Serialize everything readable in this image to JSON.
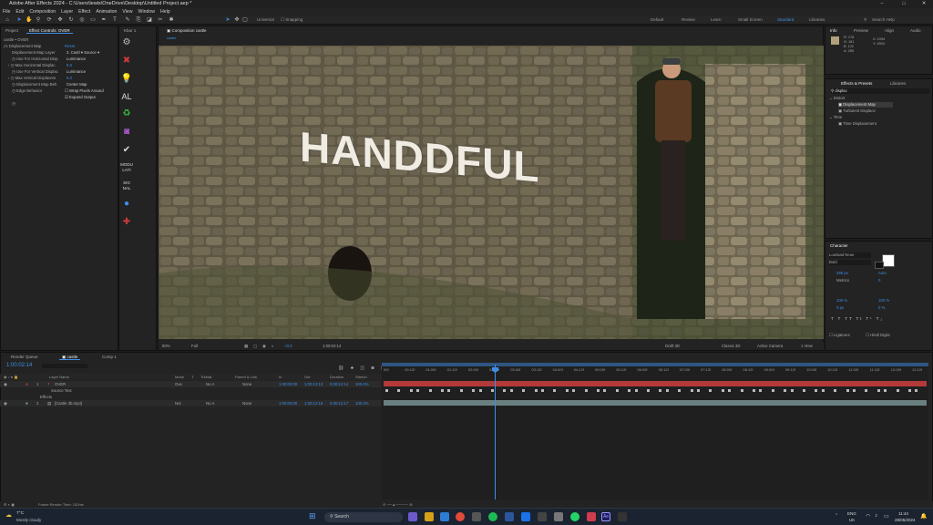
{
  "title": "Adobe After Effects 2024 - C:\\Users\\lewis\\OneDrive\\Desktop\\Untitled Project.aep *",
  "menu": [
    "File",
    "Edit",
    "Composition",
    "Layer",
    "Effect",
    "Animation",
    "View",
    "Window",
    "Help"
  ],
  "toolbar": {
    "universal": "Universal",
    "snapping": "Snapping",
    "workspaces": [
      "Default",
      "Review",
      "Learn",
      "Small Screen",
      "Standard",
      "Libraries"
    ],
    "search_placeholder": "Search Help"
  },
  "left_panel": {
    "tab_project": "Project",
    "tab_effect": "Effect Controls: OVER",
    "layer_path": "castle • OVER",
    "effect_name": "Displacement Map",
    "reset": "Reset",
    "props": [
      {
        "label": "Displacement Map Layer",
        "value": "2. Castl",
        "value2": "Source"
      },
      {
        "label": "Use For Horizontal Disp",
        "value": "Luminance"
      },
      {
        "label": "Max Horizontal Displac",
        "value": "5.0"
      },
      {
        "label": "Use For Vertical Displac",
        "value": "Luminance"
      },
      {
        "label": "Max Vertical Displacem",
        "value": "5.0"
      },
      {
        "label": "Displacement Map Beh",
        "value": "Center Map"
      },
      {
        "label": "Edge Behavior",
        "value": "Wrap Pixels Around"
      },
      {
        "label": "",
        "value": "Expand Output"
      }
    ]
  },
  "kbar": {
    "tab": "Kbar 1",
    "labels": [
      "AL",
      "MODU\nLATI",
      "SIG\nNAL"
    ]
  },
  "composition": {
    "tab": "Composition castle",
    "sub_tab": "castle",
    "overlay_text": "HANDDFUL",
    "zoom": "50%",
    "res": "Full",
    "timecode": "1:00:02:14",
    "draft": "Draft 3D",
    "renderer": "Classic 3D",
    "camera": "Active Camera",
    "views": "1 View"
  },
  "info": {
    "tabs": [
      "Info",
      "Preview",
      "Align",
      "Audio"
    ],
    "r": "R: 178",
    "g": "G: 161",
    "b": "B: 122",
    "a": "A: 255",
    "x": "X: 1094",
    "y": "Y: 1604"
  },
  "effects_presets": {
    "tabs": [
      "Effects & Presets",
      "Libraries"
    ],
    "search": "displac",
    "items": [
      "Distort",
      "Displacement Map",
      "Turbulent Displace",
      "Time",
      "Time Displacement"
    ]
  },
  "character": {
    "tab": "Character",
    "font": "Lowload Neue",
    "style": "Bold",
    "size": "290 px",
    "leading": "Auto",
    "tracking": "0",
    "kern": "Metrics",
    "h_scale": "100 %",
    "v_scale": "100 %",
    "baseline": "0 px",
    "tsume": "0 %",
    "ligatures": "Ligatures",
    "hindi": "Hindi Digits"
  },
  "timeline": {
    "tabs": [
      "Render Queue",
      "castle",
      "Comp 1"
    ],
    "timecode": "1:00:02:14",
    "headers": [
      "Layer Name",
      "Mode",
      "T",
      "TrkMat",
      "Parent & Link",
      "In",
      "Out",
      "Duration",
      "Stretch"
    ],
    "layers": [
      {
        "num": "1",
        "name": "OVER",
        "mode": "Ove",
        "trk": "No A",
        "parent": "None",
        "in": "1:00:00:00",
        "out": "1:00:12:13",
        "dur": "0:00:12:14",
        "stretch": "100.0%"
      },
      {
        "num": "",
        "name": "Source Text",
        "mode": "",
        "trk": "",
        "parent": "",
        "in": "",
        "out": "",
        "dur": "",
        "stretch": ""
      },
      {
        "num": "",
        "name": "Effects",
        "mode": "",
        "trk": "",
        "parent": "",
        "in": "",
        "out": "",
        "dur": "",
        "stretch": ""
      },
      {
        "num": "2",
        "name": "[Castle 3b.mp4]",
        "mode": "Nor",
        "trk": "No A",
        "parent": "None",
        "in": "1:00:00:00",
        "out": "1:00:12:16",
        "dur": "0:00:12:17",
        "stretch": "100.0%"
      }
    ],
    "ruler": [
      "00f",
      "00:12f",
      "01:00f",
      "01:12f",
      "02:00f",
      "02:12f",
      "03:00f",
      "03:12f",
      "04:00f",
      "04:12f",
      "05:00f",
      "05:12f",
      "06:00f",
      "06:12f",
      "07:00f",
      "07:12f",
      "08:00f",
      "08:12f",
      "09:00f",
      "09:12f",
      "10:00f",
      "10:12f",
      "11:00f",
      "11:12f",
      "12:00f",
      "12:12f"
    ],
    "render_time": "Frame Render Time: 152ms"
  },
  "taskbar": {
    "temp": "7°C",
    "weather": "Mostly cloudy",
    "search": "Search",
    "lang": "ENG",
    "region": "UK",
    "time": "11:44",
    "date": "28/05/2024"
  },
  "colors": {
    "accent": "#2d8ceb",
    "layer1": "#b33a3a",
    "layer2": "#6a8080"
  }
}
